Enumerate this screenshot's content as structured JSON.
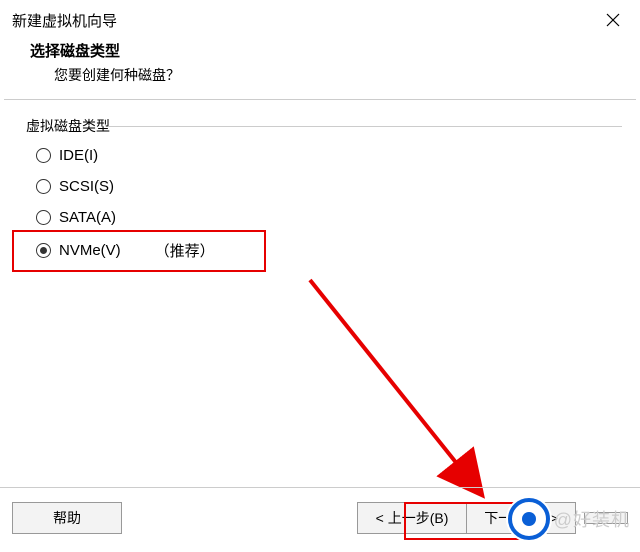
{
  "window": {
    "title": "新建虚拟机向导"
  },
  "header": {
    "title": "选择磁盘类型",
    "subtitle": "您要创建何种磁盘？"
  },
  "fieldset": {
    "legend": "虚拟磁盘类型"
  },
  "options": {
    "ide": "IDE(I)",
    "scsi": "SCSI(S)",
    "sata": "SATA(A)",
    "nvme": "NVMe(V)",
    "recommend": "（推荐）",
    "selected": "nvme"
  },
  "buttons": {
    "help": "帮助",
    "back": "< 上一步(B)",
    "next": "下一步(N) >",
    "cancel": ""
  },
  "watermark": {
    "text": "@好装机"
  }
}
